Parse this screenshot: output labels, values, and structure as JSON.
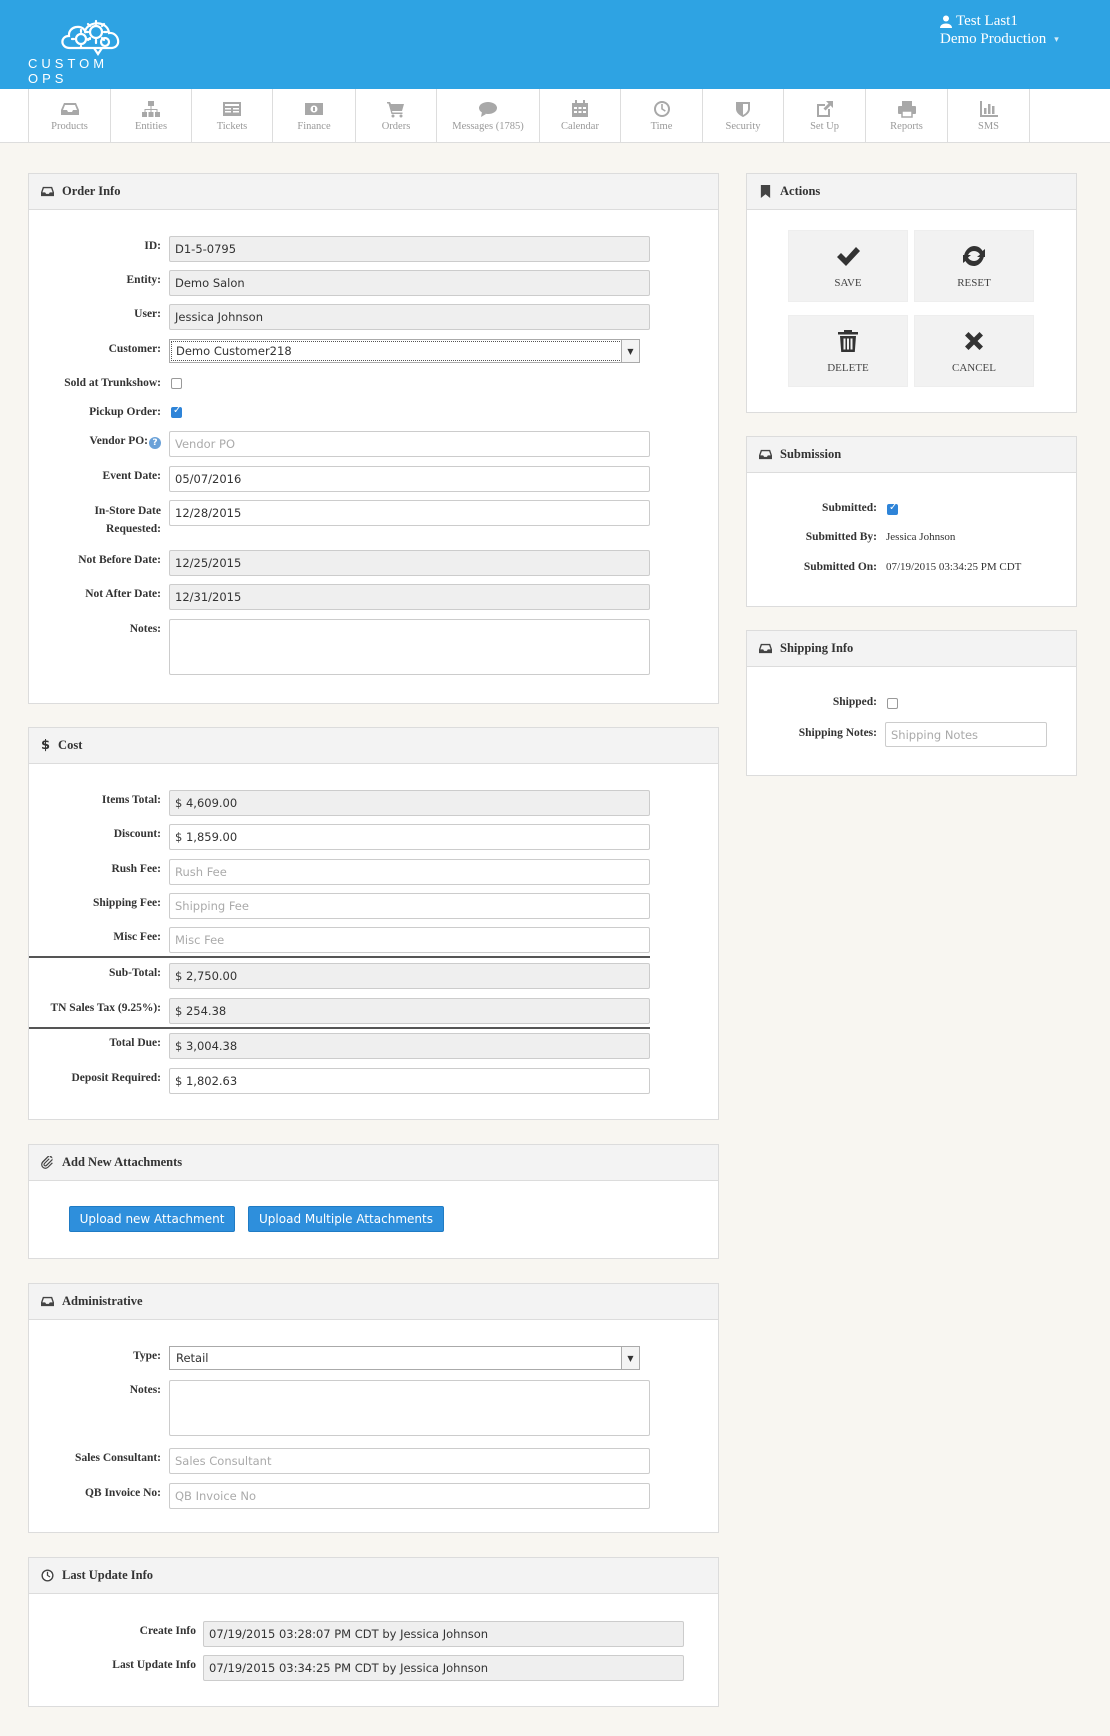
{
  "header": {
    "brand": "CUSTOM OPS",
    "user_name": "Test Last1",
    "company": "Demo Production"
  },
  "nav": [
    {
      "label": "Products",
      "icon": "inbox-icon"
    },
    {
      "label": "Entities",
      "icon": "sitemap-icon"
    },
    {
      "label": "Tickets",
      "icon": "ticket-icon"
    },
    {
      "label": "Finance",
      "icon": "money-icon"
    },
    {
      "label": "Orders",
      "icon": "cart-icon"
    },
    {
      "label": "Messages (1785)",
      "icon": "chat-icon"
    },
    {
      "label": "Calendar",
      "icon": "calendar-icon"
    },
    {
      "label": "Time",
      "icon": "clock-icon"
    },
    {
      "label": "Security",
      "icon": "shield-icon"
    },
    {
      "label": "Set Up",
      "icon": "external-link-icon"
    },
    {
      "label": "Reports",
      "icon": "printer-icon"
    },
    {
      "label": "SMS",
      "icon": "bar-chart-icon"
    }
  ],
  "order_info": {
    "title": "Order Info",
    "id_label": "ID:",
    "id_value": "D1-5-0795",
    "entity_label": "Entity:",
    "entity_value": "Demo Salon",
    "user_label": "User:",
    "user_value": "Jessica  Johnson",
    "customer_label": "Customer:",
    "customer_value": "Demo Customer218",
    "trunkshow_label": "Sold at Trunkshow:",
    "trunkshow_checked": false,
    "pickup_label": "Pickup Order:",
    "pickup_checked": true,
    "vendor_po_label": "Vendor PO:",
    "vendor_po_placeholder": "Vendor PO",
    "event_date_label": "Event Date:",
    "event_date_value": "05/07/2016",
    "instore_label_1": "In-Store Date",
    "instore_label_2": "Requested:",
    "instore_value": "12/28/2015",
    "not_before_label": "Not Before Date:",
    "not_before_value": "12/25/2015",
    "not_after_label": "Not After Date:",
    "not_after_value": "12/31/2015",
    "notes_label": "Notes:"
  },
  "cost": {
    "title": "Cost",
    "items_total_label": "Items Total:",
    "items_total_value": "$ 4,609.00",
    "discount_label": "Discount:",
    "discount_value": "$ 1,859.00",
    "rush_fee_label": "Rush Fee:",
    "rush_fee_placeholder": "Rush Fee",
    "shipping_fee_label": "Shipping Fee:",
    "shipping_fee_placeholder": "Shipping Fee",
    "misc_fee_label": "Misc Fee:",
    "misc_fee_placeholder": "Misc Fee",
    "subtotal_label": "Sub-Total:",
    "subtotal_value": "$ 2,750.00",
    "tax_label": "TN Sales Tax (9.25%):",
    "tax_value": "$ 254.38",
    "total_due_label": "Total Due:",
    "total_due_value": "$ 3,004.38",
    "deposit_label": "Deposit Required:",
    "deposit_value": "$ 1,802.63"
  },
  "attachments": {
    "title": "Add New Attachments",
    "upload_one": "Upload new Attachment",
    "upload_multi": "Upload Multiple Attachments"
  },
  "administrative": {
    "title": "Administrative",
    "type_label": "Type:",
    "type_value": "Retail",
    "notes_label": "Notes:",
    "consultant_label": "Sales Consultant:",
    "consultant_placeholder": "Sales Consultant",
    "qb_label": "QB Invoice No:",
    "qb_placeholder": "QB Invoice No"
  },
  "last_update": {
    "title": "Last Update Info",
    "create_label": "Create Info",
    "create_value": "07/19/2015 03:28:07 PM CDT by Jessica  Johnson",
    "update_label": "Last Update Info",
    "update_value": "07/19/2015 03:34:25 PM CDT by Jessica  Johnson"
  },
  "actions": {
    "title": "Actions",
    "save": "SAVE",
    "reset": "RESET",
    "delete": "DELETE",
    "cancel": "CANCEL"
  },
  "submission": {
    "title": "Submission",
    "submitted_label": "Submitted:",
    "submitted_checked": true,
    "submitted_by_label": "Submitted By:",
    "submitted_by_value": "Jessica Johnson",
    "submitted_on_label": "Submitted On:",
    "submitted_on_value": "07/19/2015 03:34:25 PM CDT"
  },
  "shipping": {
    "title": "Shipping Info",
    "shipped_label": "Shipped:",
    "shipped_checked": false,
    "notes_label": "Shipping Notes:",
    "notes_placeholder": "Shipping Notes"
  }
}
